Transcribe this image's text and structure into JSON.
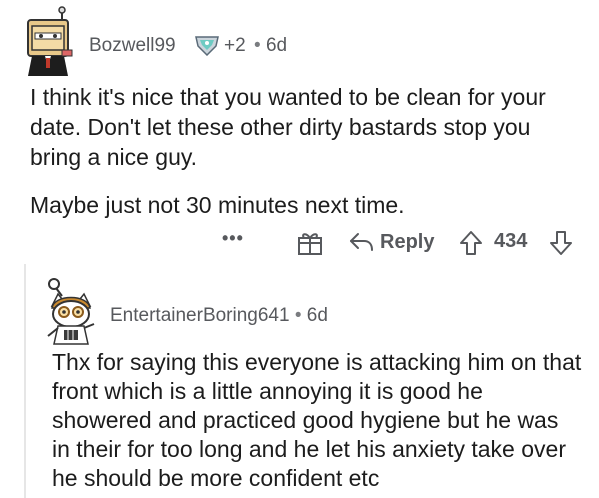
{
  "comment": {
    "username": "Bozwell99",
    "award_count": "+2",
    "separator": "•",
    "timestamp": "6d",
    "paragraphs": [
      "I think it's nice that you wanted to be clean for your date. Don't let these other dirty bastards stop you bring a nice guy.",
      "Maybe just not 30 minutes next time."
    ],
    "actions": {
      "more_label": "•••",
      "reply_label": "Reply",
      "vote_count": "434"
    }
  },
  "reply": {
    "username": "EntertainerBoring641",
    "separator": "•",
    "timestamp": "6d",
    "text": "Thx for saying this everyone is attacking him on that front which is a little annoying it is good he showered and practiced good hygiene but he was in their for too long and he let his anxiety take over he should be more confident etc"
  },
  "colors": {
    "text": "#1c1c1c",
    "meta": "#57595d",
    "thread_line": "#e6e6e6"
  },
  "icons": [
    "avatar-top",
    "award-icon",
    "more-icon",
    "gift-award-icon",
    "reply-icon",
    "upvote-icon",
    "downvote-icon",
    "avatar-reply"
  ]
}
